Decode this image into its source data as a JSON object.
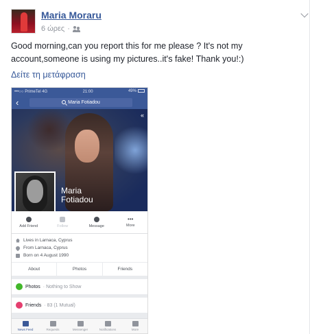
{
  "post": {
    "author": "Maria Moraru",
    "time": "6 ώρες",
    "separator": "·",
    "text": "Good morning,can you report this for me please ? It's not my account,someone is using my pictures..it's fake! Thank you!:)",
    "translate": "Δείτε τη μετάφραση"
  },
  "phone": {
    "status": {
      "carrier": "•••○○ PrimeTel  4G",
      "time": "21:00",
      "battery": "49%"
    },
    "search_text": "Maria Fotiadou",
    "profile_name_line1": "Maria",
    "profile_name_line2": "Fotiadou",
    "actions": [
      {
        "label": "Add Friend"
      },
      {
        "label": "Follow"
      },
      {
        "label": "Message"
      },
      {
        "label": "More"
      }
    ],
    "info": [
      {
        "text": "Lives in Larnaca, Cyprus"
      },
      {
        "text": "From Larnaca, Cyprus"
      },
      {
        "text": "Born on 4 August 1990"
      }
    ],
    "tabs": [
      {
        "label": "About"
      },
      {
        "label": "Photos"
      },
      {
        "label": "Friends"
      }
    ],
    "photos_section": {
      "title": "Photos",
      "sub": "· Nothing to Show"
    },
    "friends_section": {
      "title": "Friends",
      "sub": "· 83 (1 Mutual)"
    },
    "bottom_nav": [
      {
        "label": "News Feed"
      },
      {
        "label": "Requests"
      },
      {
        "label": "Messenger"
      },
      {
        "label": "Notifications"
      },
      {
        "label": "More"
      }
    ]
  },
  "colors": {
    "link": "#365899",
    "facebook_blue": "#3b5998",
    "meta_gray": "#90949c"
  }
}
